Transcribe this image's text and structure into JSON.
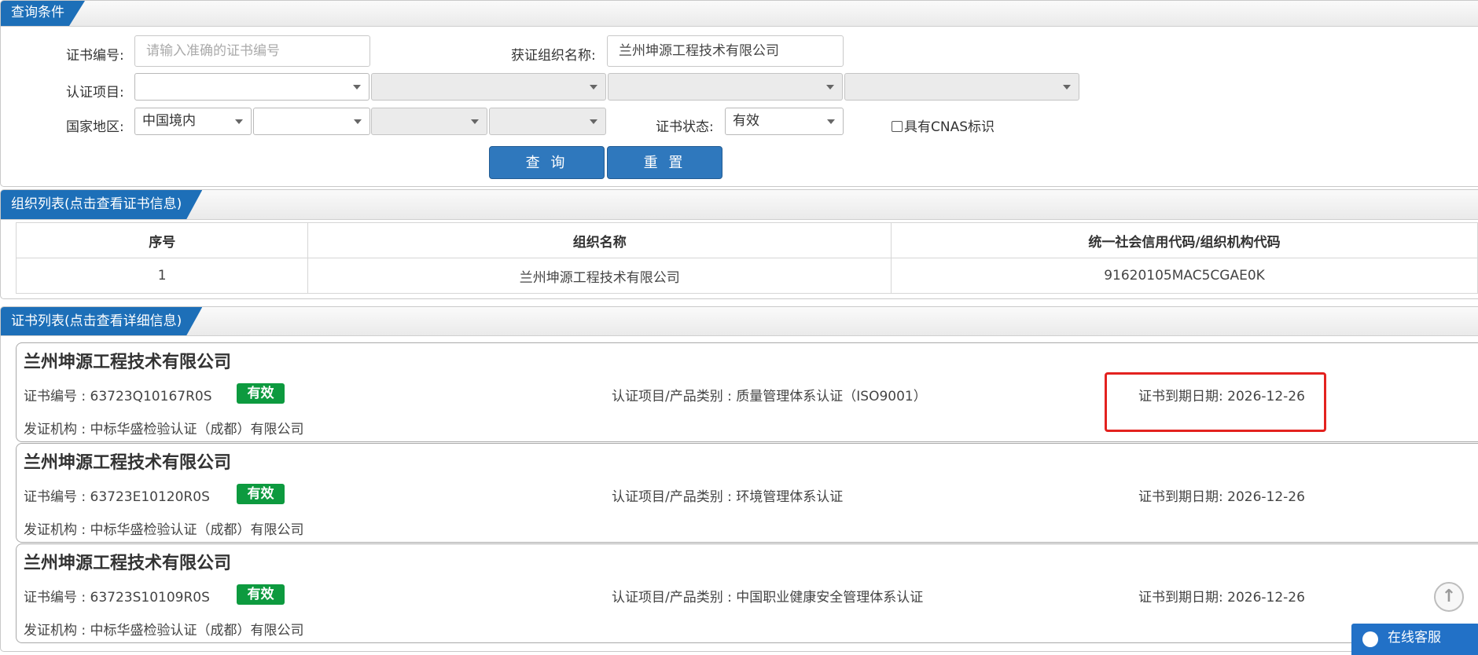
{
  "query_panel": {
    "title": "查询条件",
    "cert_no_label": "证书编号:",
    "cert_no_placeholder": "请输入准确的证书编号",
    "org_name_label": "获证组织名称:",
    "org_name_value": "兰州坤源工程技术有限公司",
    "cert_item_label": "认证项目:",
    "region_label": "国家地区:",
    "region_value": "中国境内",
    "status_label": "证书状态:",
    "status_value": "有效",
    "cnas_label": "具有CNAS标识",
    "search_button": "查 询",
    "reset_button": "重 置"
  },
  "org_panel": {
    "title": "组织列表(点击查看证书信息)",
    "columns": [
      "序号",
      "组织名称",
      "统一社会信用代码/组织机构代码"
    ],
    "rows": [
      {
        "index": "1",
        "name": "兰州坤源工程技术有限公司",
        "code": "91620105MAC5CGAE0K"
      }
    ]
  },
  "cert_panel": {
    "title": "证书列表(点击查看详细信息)",
    "certs": [
      {
        "org": "兰州坤源工程技术有限公司",
        "number": "证书编号 : 63723Q10167R0S",
        "status": "有效",
        "item": "认证项目/产品类别 : 质量管理体系认证（ISO9001）",
        "expiry": "证书到期日期: 2026-12-26",
        "issuer": "发证机构 : 中标华盛检验认证（成都）有限公司"
      },
      {
        "org": "兰州坤源工程技术有限公司",
        "number": "证书编号 : 63723E10120R0S",
        "status": "有效",
        "item": "认证项目/产品类别 : 环境管理体系认证",
        "expiry": "证书到期日期: 2026-12-26",
        "issuer": "发证机构 : 中标华盛检验认证（成都）有限公司"
      },
      {
        "org": "兰州坤源工程技术有限公司",
        "number": "证书编号 : 63723S10109R0S",
        "status": "有效",
        "item": "认证项目/产品类别 : 中国职业健康安全管理体系认证",
        "expiry": "证书到期日期: 2026-12-26",
        "issuer": "发证机构 : 中标华盛检验认证（成都）有限公司"
      }
    ]
  },
  "online_service": "在线客服",
  "colors": {
    "tab_blue": "#1d6fb8",
    "button_blue": "#2f78bd",
    "valid_green": "#0d9a3f",
    "highlight_red": "#e3221f"
  },
  "icons": {
    "back_to_top": "arrow-up-circle-icon",
    "chat": "chat-icon"
  }
}
